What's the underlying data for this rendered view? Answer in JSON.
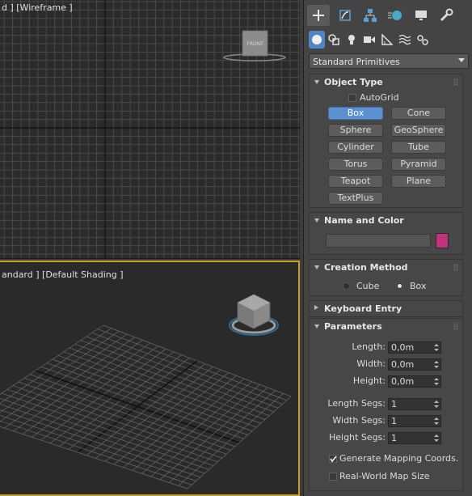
{
  "viewports": {
    "top": {
      "label": "d ] [Wireframe ]",
      "viewcube_label": "FRONT"
    },
    "perspective": {
      "label": "andard ] [Default Shading ]"
    }
  },
  "command_panel": {
    "tabs": [
      "create-icon",
      "modify-icon",
      "hierarchy-icon",
      "motion-icon",
      "display-icon",
      "utilities-icon"
    ],
    "subtabs": [
      "geometry-icon",
      "shapes-icon",
      "lights-icon",
      "cameras-icon",
      "helpers-icon",
      "spacewarps-icon",
      "systems-icon"
    ],
    "category_dropdown": "Standard Primitives",
    "object_type": {
      "title": "Object Type",
      "autogrid": "AutoGrid",
      "buttons": [
        "Box",
        "Cone",
        "Sphere",
        "GeoSphere",
        "Cylinder",
        "Tube",
        "Torus",
        "Pyramid",
        "Teapot",
        "Plane",
        "TextPlus"
      ],
      "active": "Box"
    },
    "name_and_color": {
      "title": "Name and Color",
      "name_value": "",
      "color": "#c0327a"
    },
    "creation_method": {
      "title": "Creation Method",
      "options": [
        "Cube",
        "Box"
      ],
      "selected": "Box"
    },
    "keyboard_entry": {
      "title": "Keyboard Entry"
    },
    "parameters": {
      "title": "Parameters",
      "length_label": "Length:",
      "length": "0,0m",
      "width_label": "Width:",
      "width": "0,0m",
      "height_label": "Height:",
      "height": "0,0m",
      "length_segs_label": "Length Segs:",
      "length_segs": "1",
      "width_segs_label": "Width Segs:",
      "width_segs": "1",
      "height_segs_label": "Height Segs:",
      "height_segs": "1",
      "gen_mapping": "Generate Mapping Coords.",
      "gen_mapping_checked": true,
      "real_world": "Real-World Map Size",
      "real_world_checked": false
    }
  },
  "colors": {
    "accent": "#5b8fd0",
    "active_border": "#c8a020"
  }
}
